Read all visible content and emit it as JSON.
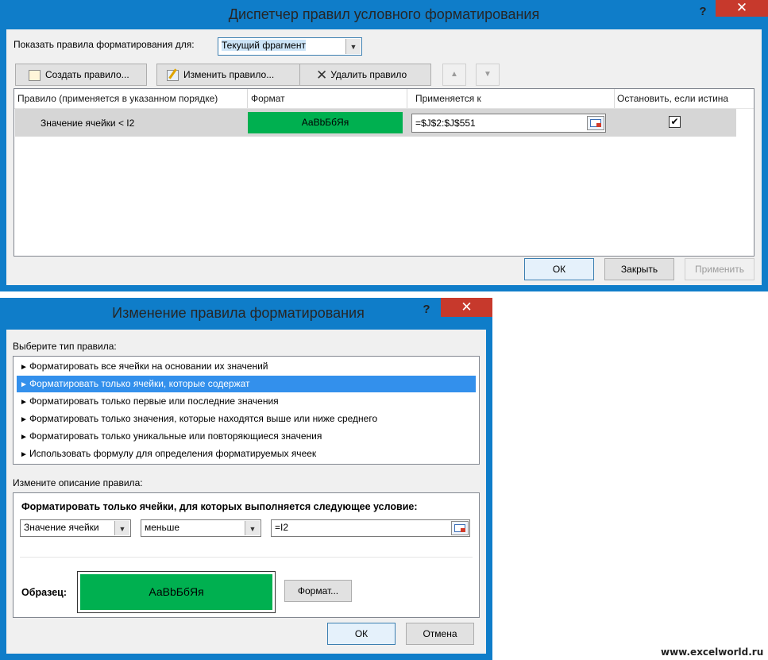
{
  "manager": {
    "title": "Диспетчер правил условного форматирования",
    "help_glyph": "?",
    "close_glyph": "✕",
    "show_rules_label": "Показать правила форматирования для:",
    "show_rules_value": "Текущий фрагмент",
    "toolbar": {
      "create": "Создать правило...",
      "edit": "Изменить правило...",
      "delete": "Удалить правило",
      "up_glyph": "▲",
      "down_glyph": "▼"
    },
    "columns": {
      "rule": "Правило (применяется в указанном порядке)",
      "format": "Формат",
      "applies": "Применяется к",
      "stop": "Остановить, если истина"
    },
    "rows": [
      {
        "rule": "Значение ячейки < I2",
        "format_sample": "АаBbБбЯя",
        "applies_to": "=$J$2:$J$551",
        "stop_checked": "✔"
      }
    ],
    "buttons": {
      "ok": "ОК",
      "close": "Закрыть",
      "apply": "Применить"
    }
  },
  "edit": {
    "title": "Изменение правила форматирования",
    "help_glyph": "?",
    "close_glyph": "✕",
    "select_type_label": "Выберите тип правила:",
    "rule_types": [
      "Форматировать все ячейки на основании их значений",
      "Форматировать только ячейки, которые содержат",
      "Форматировать только первые или последние значения",
      "Форматировать только значения, которые находятся выше или ниже среднего",
      "Форматировать только уникальные или повторяющиеся значения",
      "Использовать формулу для определения форматируемых ячеек"
    ],
    "selected_index": 1,
    "bullet": "►",
    "edit_desc_label": "Измените описание правила:",
    "condition_heading": "Форматировать только ячейки, для которых выполняется следующее условие:",
    "cond_type": "Значение ячейки",
    "operator": "меньше",
    "value": "=I2",
    "preview_label": "Образец:",
    "preview_sample": "АаBbБбЯя",
    "format_button": "Формат...",
    "ok": "ОК",
    "cancel": "Отмена"
  },
  "watermark": "www.excelworld.ru",
  "colors": {
    "title_bar": "#0f7dc9",
    "close": "#c7392c",
    "green_sample": "#00b050",
    "selection": "#3390ec",
    "row_selected": "#d6d6d6"
  }
}
